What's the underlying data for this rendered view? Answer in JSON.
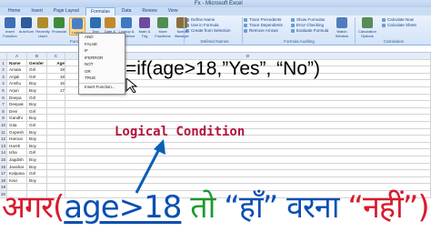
{
  "window": {
    "title": "Fx - Microsoft Excel"
  },
  "tabs": [
    "Home",
    "Insert",
    "Page Layout",
    "Formulas",
    "Data",
    "Review",
    "View"
  ],
  "active_tab": "Formulas",
  "ribbon": {
    "buttons": [
      {
        "label": "Insert Function",
        "color": "#3f6fb5"
      },
      {
        "label": "AutoSum",
        "color": "#2f5a9b"
      },
      {
        "label": "Recently Used",
        "color": "#b08a2c"
      },
      {
        "label": "Financial",
        "color": "#3d8a3d"
      },
      {
        "label": "Logical",
        "color": "#4a7fc8"
      },
      {
        "label": "Text",
        "color": "#2a6fb0"
      },
      {
        "label": "Date & Time",
        "color": "#c2892c"
      },
      {
        "label": "Lookup & Reference",
        "color": "#3c7ac2"
      },
      {
        "label": "Math & Trig",
        "color": "#6d4ba0"
      },
      {
        "label": "More Functions",
        "color": "#4f8e4f"
      }
    ],
    "name_manager": "Name Manager",
    "defined_names": [
      "Define Name",
      "Use in Formula",
      "Create from Selection"
    ],
    "auditing": [
      "Trace Precedents",
      "Trace Dependents",
      "Remove Arrows"
    ],
    "auditing2": [
      "Show Formulas",
      "Error Checking",
      "Evaluate Formula"
    ],
    "watch": "Watch Window",
    "calc_options": "Calculation Options",
    "calc": [
      "Calculate Now",
      "Calculate Sheet"
    ],
    "groups": [
      "Function Library",
      "Defined Names",
      "Formula Auditing",
      "Calculation"
    ]
  },
  "logical_menu": [
    "AND",
    "FALSE",
    "IF",
    "IFERROR",
    "NOT",
    "OR",
    "TRUE",
    "Insert Function..."
  ],
  "sheet": {
    "columns": [
      "A",
      "B",
      "C",
      "D"
    ],
    "rows": [
      {
        "n": "1",
        "a": "Name",
        "b": "Gender",
        "c": "Age",
        "d": ""
      },
      {
        "n": "2",
        "a": "Amala",
        "b": "Girl",
        "c": "19",
        "d": ""
      },
      {
        "n": "3",
        "a": "Anjali",
        "b": "Girl",
        "c": "18",
        "d": ""
      },
      {
        "n": "4",
        "a": "Anshu",
        "b": "Boy",
        "c": "16",
        "d": ""
      },
      {
        "n": "5",
        "a": "Arjun",
        "b": "Boy",
        "c": "17",
        "d": ""
      },
      {
        "n": "6",
        "a": "Deepa",
        "b": "Girl",
        "c": "",
        "d": ""
      },
      {
        "n": "7",
        "a": "Deepak",
        "b": "Boy",
        "c": "",
        "d": ""
      },
      {
        "n": "8",
        "a": "Devi",
        "b": "Girl",
        "c": "",
        "d": ""
      },
      {
        "n": "9",
        "a": "Gandhi",
        "b": "Boy",
        "c": "",
        "d": ""
      },
      {
        "n": "10",
        "a": "Gita",
        "b": "Girl",
        "c": "",
        "d": ""
      },
      {
        "n": "11",
        "a": "Gopesh",
        "b": "Boy",
        "c": "",
        "d": ""
      },
      {
        "n": "12",
        "a": "Haroun",
        "b": "Boy",
        "c": "",
        "d": ""
      },
      {
        "n": "13",
        "a": "Harsh",
        "b": "Boy",
        "c": "",
        "d": ""
      },
      {
        "n": "14",
        "a": "Isha",
        "b": "Girl",
        "c": "",
        "d": ""
      },
      {
        "n": "15",
        "a": "Jagdish",
        "b": "Boy",
        "c": "",
        "d": ""
      },
      {
        "n": "16",
        "a": "Javahar",
        "b": "Boy",
        "c": "",
        "d": ""
      },
      {
        "n": "17",
        "a": "Kalpana",
        "b": "Girl",
        "c": "",
        "d": ""
      },
      {
        "n": "18",
        "a": "Kavi",
        "b": "Boy",
        "c": "",
        "d": ""
      },
      {
        "n": "19",
        "a": "",
        "b": "",
        "c": "",
        "d": ""
      },
      {
        "n": "20",
        "a": "",
        "b": "",
        "c": "",
        "d": ""
      }
    ]
  },
  "overlay": {
    "formula": "=if(age>18,”Yes”, “No”)",
    "annotation": "Logical Condition",
    "hindi_1": "अगर(",
    "hindi_2": "age>18",
    "hindi_3": " तो ",
    "hindi_4": "“हाँ” वरना ",
    "hindi_5": "“नहीं”)"
  }
}
